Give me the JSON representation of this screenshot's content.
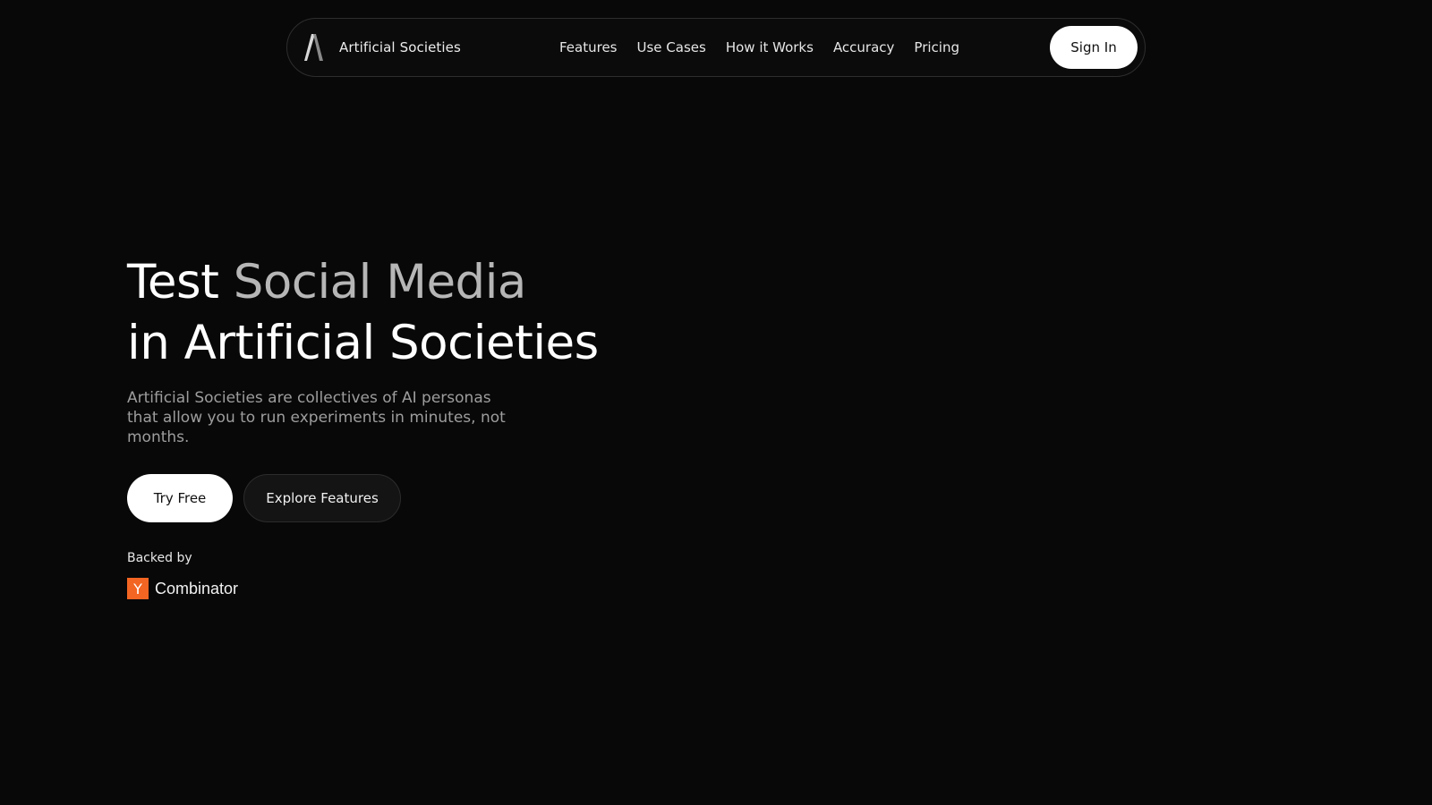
{
  "nav": {
    "logo_icon": "artificial-societies-logo-icon",
    "brand_name": "Artificial Societies",
    "links": [
      "Features",
      "Use Cases",
      "How it Works",
      "Accuracy",
      "Pricing"
    ],
    "signin_label": "Sign In"
  },
  "hero": {
    "headline_part1": "Test",
    "headline_part2": "Social Media",
    "headline_line2": "in Artificial Societies",
    "subtitle": "Artificial Societies are collectives of AI personas that allow you to run experiments in minutes, not months.",
    "primary_cta": "Try Free",
    "secondary_cta": "Explore Features",
    "backed_label": "Backed by",
    "backer_mark": "Y",
    "backer_name": "Combinator"
  },
  "colors": {
    "background": "#080808",
    "accent_yc": "#f26522",
    "muted_headline": "#b6b6b6"
  }
}
